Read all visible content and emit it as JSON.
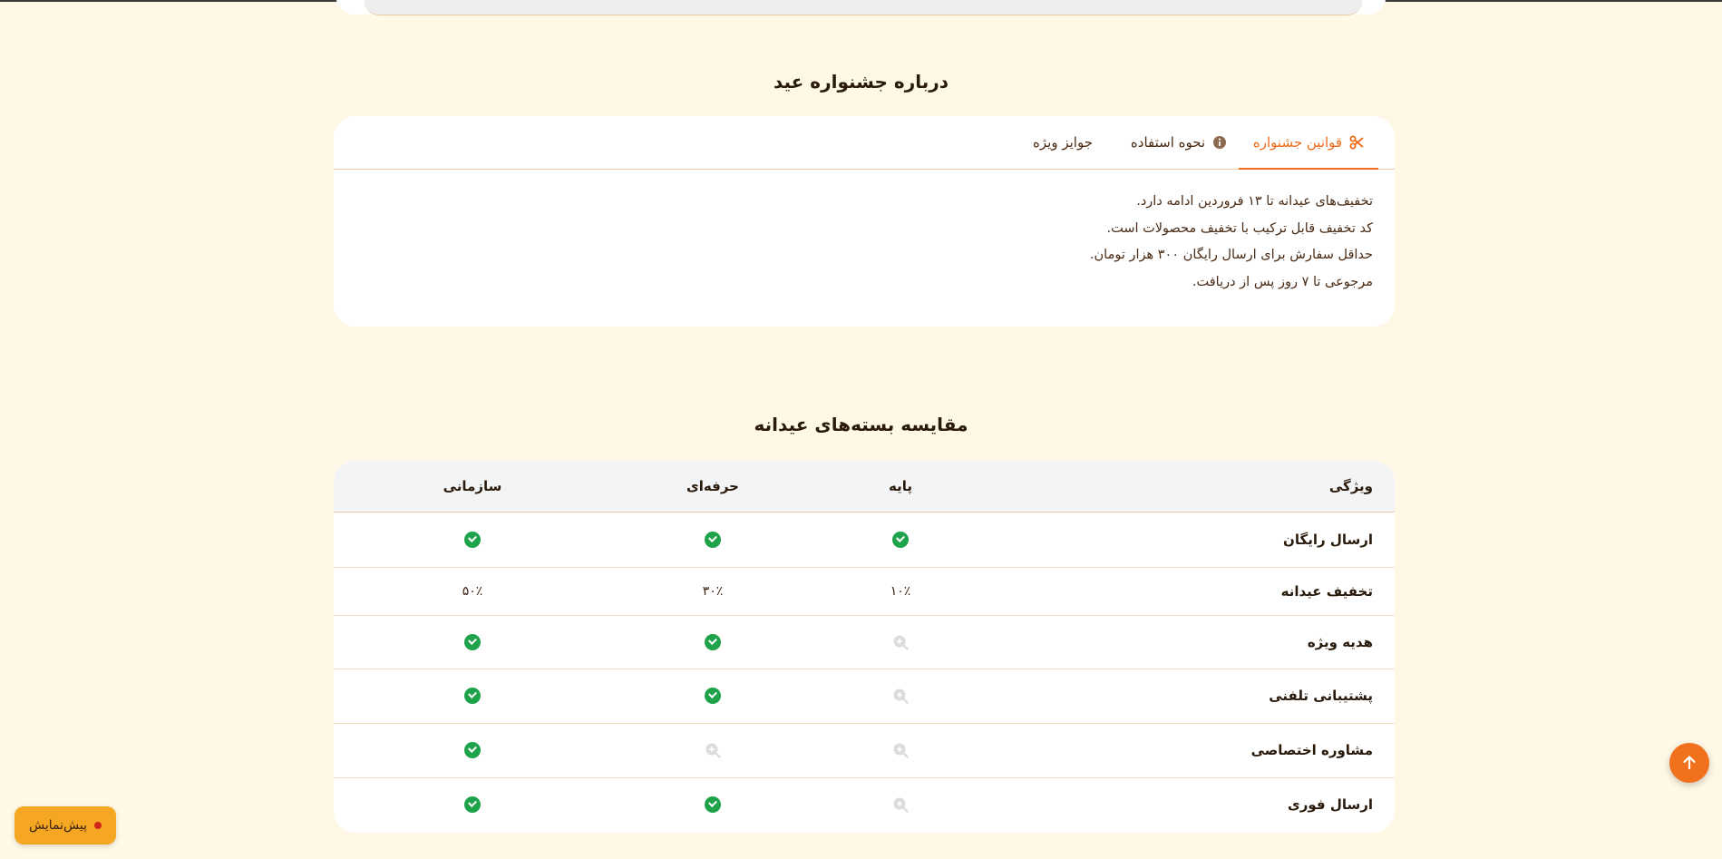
{
  "about": {
    "title": "درباره جشنواره عید",
    "tabs": [
      {
        "label": "قوانین جشنواره",
        "icon": "scissors-icon",
        "active": true
      },
      {
        "label": "نحوه استفاده",
        "icon": "info-icon",
        "active": false
      },
      {
        "label": "جوایز ویژه",
        "icon": "",
        "active": false
      }
    ],
    "rules": [
      "تخفیف‌های عیدانه تا ۱۳ فروردین ادامه دارد.",
      "کد تخفیف قابل ترکیب با تخفیف محصولات است.",
      "حداقل سفارش برای ارسال رایگان ۳۰۰ هزار تومان.",
      "مرجوعی تا ۷ روز پس از دریافت."
    ]
  },
  "comparison": {
    "title": "مقایسه بسته‌های عیدانه",
    "headers": {
      "feature": "ویژگی",
      "basic": "پایه",
      "pro": "حرفه‌ای",
      "org": "سازمانی"
    },
    "rows": [
      {
        "feature": "ارسال رایگان",
        "basic": "check",
        "pro": "check",
        "org": "check"
      },
      {
        "feature": "تخفیف عیدانه",
        "basic": "۱۰٪",
        "pro": "۳۰٪",
        "org": "۵۰٪"
      },
      {
        "feature": "هدیه ویژه",
        "basic": "unavailable",
        "pro": "check",
        "org": "check"
      },
      {
        "feature": "پشتیبانی تلفنی",
        "basic": "unavailable",
        "pro": "check",
        "org": "check"
      },
      {
        "feature": "مشاوره اختصاصی",
        "basic": "unavailable",
        "pro": "unavailable",
        "org": "check"
      },
      {
        "feature": "ارسال فوری",
        "basic": "unavailable",
        "pro": "check",
        "org": "check"
      }
    ]
  },
  "floating": {
    "preview_label": "پیش‌نمایش",
    "scroll_top_icon": "arrow-up-icon"
  },
  "colors": {
    "background": "#fff8e6",
    "accent": "#ef6a1a",
    "check": "#1fa34a",
    "preview_button": "#f5a623"
  }
}
